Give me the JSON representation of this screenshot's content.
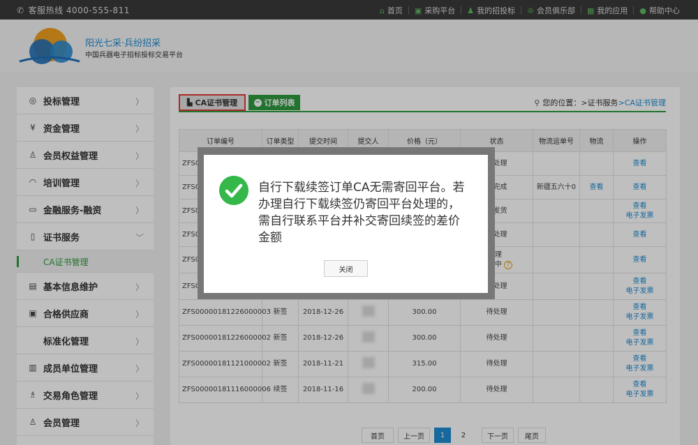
{
  "topbar": {
    "hotline": "客服热线 4000-555-811",
    "nav": [
      {
        "icon": "home-icon",
        "glyph": "⌂",
        "label": "首页"
      },
      {
        "icon": "cart-icon",
        "glyph": "▣",
        "label": "采购平台"
      },
      {
        "icon": "user-icon",
        "glyph": "♟",
        "label": "我的招投标"
      },
      {
        "icon": "crown-icon",
        "glyph": "♔",
        "label": "会员俱乐部"
      },
      {
        "icon": "apps-icon",
        "glyph": "▦",
        "label": "我的应用"
      },
      {
        "icon": "help-icon",
        "glyph": "●",
        "label": "帮助中心"
      }
    ]
  },
  "header": {
    "brand_title": "阳光七采·兵纷招采",
    "brand_subtitle": "中国兵器电子招标投标交易平台"
  },
  "sidebar": {
    "items": [
      {
        "icon": "bid-icon",
        "glyph": "◎",
        "label": "投标管理"
      },
      {
        "icon": "fund-icon",
        "glyph": "¥",
        "label": "资金管理"
      },
      {
        "icon": "member-rights-icon",
        "glyph": "♙",
        "label": "会员权益管理"
      },
      {
        "icon": "training-icon",
        "glyph": "◠",
        "label": "培训管理"
      },
      {
        "icon": "finance-icon",
        "glyph": "▭",
        "label": "金融服务-融资"
      },
      {
        "icon": "certificate-icon",
        "glyph": "▯",
        "label": "证书服务"
      },
      {
        "icon": "info-icon",
        "glyph": "▤",
        "label": "基本信息维护"
      },
      {
        "icon": "supplier-icon",
        "glyph": "▣",
        "label": "合格供应商"
      },
      {
        "icon": "standard-icon",
        "glyph": "",
        "label": "标准化管理"
      },
      {
        "icon": "unit-icon",
        "glyph": "▥",
        "label": "成员单位管理"
      },
      {
        "icon": "role-icon",
        "glyph": "♗",
        "label": "交易角色管理"
      },
      {
        "icon": "members-icon",
        "glyph": "♙",
        "label": "会员管理"
      }
    ],
    "sub_item": "CA证书管理"
  },
  "main": {
    "tab_ca": "CA证书管理",
    "tab_orders": "订单列表",
    "location_label": "您的位置：",
    "location_path": ">证书服务",
    "location_current": ">CA证书管理",
    "table": {
      "headers": [
        "订单编号",
        "订单类型",
        "提交时间",
        "提交人",
        "价格（元）",
        "状态",
        "物流运单号",
        "物流",
        "操作"
      ],
      "rows": [
        {
          "id": "ZFS0000",
          "type": "",
          "time": "",
          "price": "",
          "status": "待处理",
          "tracking": "",
          "logistics": "",
          "actions": [
            "查看"
          ]
        },
        {
          "id": "ZFS0000",
          "type": "",
          "time": "",
          "price": "",
          "status": "已完成",
          "tracking": "新疆五六十0",
          "logistics": "查看",
          "actions": [
            "查看"
          ]
        },
        {
          "id": "ZFS0000",
          "type": "",
          "time": "",
          "price": "",
          "status": "已发货",
          "tracking": "",
          "logistics": "",
          "actions": [
            "查看",
            "电子发票"
          ]
        },
        {
          "id": "ZFS0000",
          "type": "",
          "time": "",
          "price": "",
          "status": "待处理",
          "tracking": "",
          "logistics": "",
          "actions": [
            "查看"
          ]
        },
        {
          "id": "ZFS00001",
          "type": "",
          "time": "",
          "price": "",
          "status": "待处理\n开票中",
          "tracking": "",
          "logistics": "",
          "actions": [
            "查看"
          ]
        },
        {
          "id": "ZFS0000",
          "type": "",
          "time": "",
          "price": "",
          "status": "待处理",
          "tracking": "",
          "logistics": "",
          "actions": [
            "查看",
            "电子发票"
          ]
        },
        {
          "id": "ZFS00000181226000003",
          "type": "新签",
          "time": "2018-12-26",
          "price": "300.00",
          "status": "待处理",
          "tracking": "",
          "logistics": "",
          "actions": [
            "查看",
            "电子发票"
          ]
        },
        {
          "id": "ZFS00000181226000002",
          "type": "新签",
          "time": "2018-12-26",
          "price": "300.00",
          "status": "待处理",
          "tracking": "",
          "logistics": "",
          "actions": [
            "查看",
            "电子发票"
          ]
        },
        {
          "id": "ZFS00000181121000002",
          "type": "新签",
          "time": "2018-11-21",
          "price": "315.00",
          "status": "待处理",
          "tracking": "",
          "logistics": "",
          "actions": [
            "查看",
            "电子发票"
          ]
        },
        {
          "id": "ZFS00000181116000006",
          "type": "续签",
          "time": "2018-11-16",
          "price": "200.00",
          "status": "待处理",
          "tracking": "",
          "logistics": "",
          "actions": [
            "查看",
            "电子发票"
          ]
        }
      ]
    },
    "pager": {
      "first": "首页",
      "prev": "上一页",
      "pages": [
        "1",
        "2"
      ],
      "next": "下一页",
      "last": "尾页"
    }
  },
  "modal": {
    "message": "自行下载续签订单CA无需寄回平台。若办理自行下载续签仍寄回平台处理的，需自行联系平台并补交寄回续签的差价金额",
    "close_label": "关闭"
  },
  "colors": {
    "accent_green": "#2e9a3d",
    "link_blue": "#1f8bd1",
    "highlight_red": "#e53935",
    "success_green": "#35b84a"
  }
}
